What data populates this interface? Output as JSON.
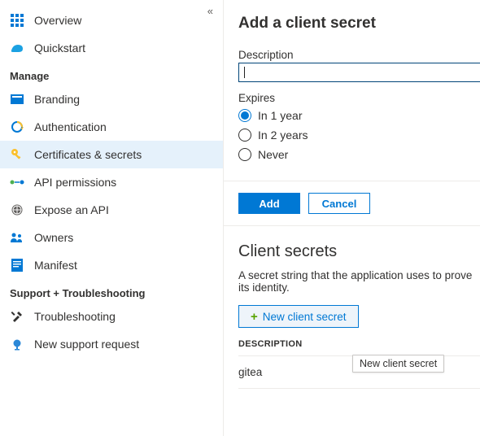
{
  "sidebar": {
    "top": [
      {
        "icon": "overview",
        "label": "Overview"
      },
      {
        "icon": "quickstart",
        "label": "Quickstart"
      }
    ],
    "groups": [
      {
        "title": "Manage",
        "items": [
          {
            "icon": "branding",
            "label": "Branding"
          },
          {
            "icon": "auth",
            "label": "Authentication"
          },
          {
            "icon": "cert",
            "label": "Certificates & secrets",
            "selected": true
          },
          {
            "icon": "apiperm",
            "label": "API permissions"
          },
          {
            "icon": "expose",
            "label": "Expose an API"
          },
          {
            "icon": "owners",
            "label": "Owners"
          },
          {
            "icon": "manifest",
            "label": "Manifest"
          }
        ]
      },
      {
        "title": "Support + Troubleshooting",
        "items": [
          {
            "icon": "trouble",
            "label": "Troubleshooting"
          },
          {
            "icon": "support",
            "label": "New support request"
          }
        ]
      }
    ]
  },
  "addPane": {
    "title": "Add a client secret",
    "descLabel": "Description",
    "descValue": "",
    "expiresLabel": "Expires",
    "options": [
      {
        "label": "In 1 year",
        "selected": true
      },
      {
        "label": "In 2 years",
        "selected": false
      },
      {
        "label": "Never",
        "selected": false
      }
    ],
    "add": "Add",
    "cancel": "Cancel"
  },
  "secrets": {
    "heading": "Client secrets",
    "desc": "A secret string that the application uses to prove its identity.",
    "newBtn": "New client secret",
    "tooltip": "New client secret",
    "colDesc": "Description",
    "rows": [
      {
        "desc": "gitea"
      }
    ]
  }
}
